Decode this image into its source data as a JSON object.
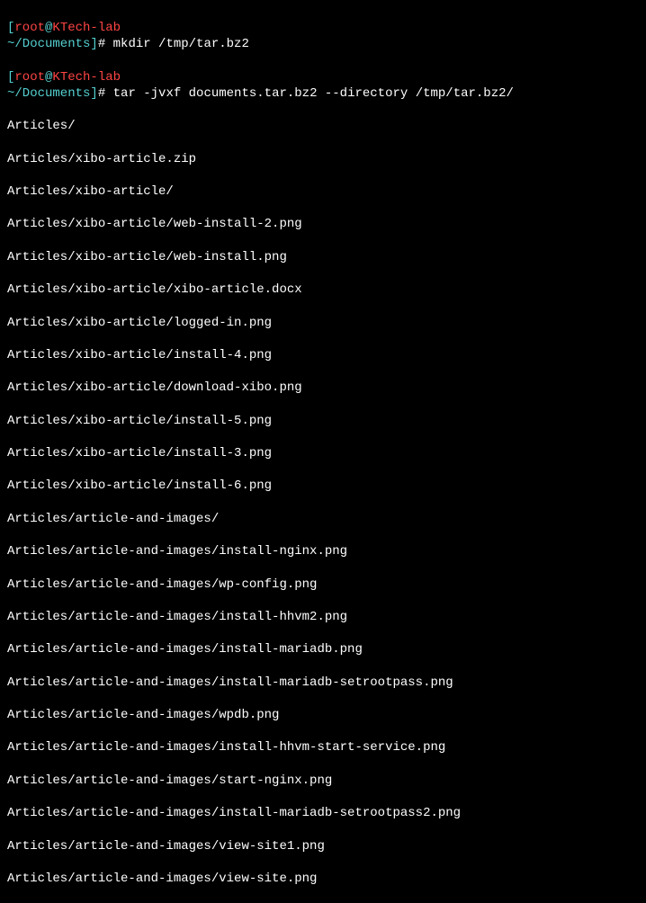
{
  "prompts": [
    {
      "bracket_open": "[",
      "user": "root",
      "at": "@",
      "host": "KTech-lab",
      "path": "~/Documents",
      "bracket_close": "]",
      "hash": "#",
      "command": " mkdir /tmp/tar.bz2"
    },
    {
      "bracket_open": "[",
      "user": "root",
      "at": "@",
      "host": "KTech-lab",
      "path": "~/Documents",
      "bracket_close": "]",
      "hash": "#",
      "command": " tar -jvxf documents.tar.bz2 --directory /tmp/tar.bz2/"
    }
  ],
  "output": [
    "Articles/",
    "Articles/xibo-article.zip",
    "Articles/xibo-article/",
    "Articles/xibo-article/web-install-2.png",
    "Articles/xibo-article/web-install.png",
    "Articles/xibo-article/xibo-article.docx",
    "Articles/xibo-article/logged-in.png",
    "Articles/xibo-article/install-4.png",
    "Articles/xibo-article/download-xibo.png",
    "Articles/xibo-article/install-5.png",
    "Articles/xibo-article/install-3.png",
    "Articles/xibo-article/install-6.png",
    "Articles/article-and-images/",
    "Articles/article-and-images/install-nginx.png",
    "Articles/article-and-images/wp-config.png",
    "Articles/article-and-images/install-hhvm2.png",
    "Articles/article-and-images/install-mariadb.png",
    "Articles/article-and-images/install-mariadb-setrootpass.png",
    "Articles/article-and-images/wpdb.png",
    "Articles/article-and-images/install-hhvm-start-service.png",
    "Articles/article-and-images/start-nginx.png",
    "Articles/article-and-images/install-mariadb-setrootpass2.png",
    "Articles/article-and-images/view-site1.png",
    "Articles/article-and-images/view-site.png"
  ]
}
